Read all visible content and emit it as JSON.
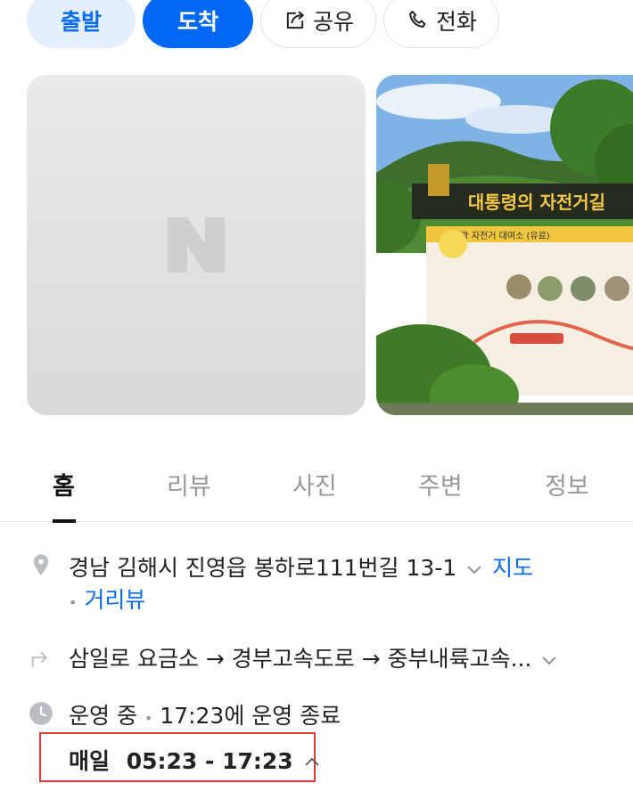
{
  "actions": {
    "depart": "출발",
    "arrive": "도착",
    "share": "공유",
    "call": "전화"
  },
  "photos": {
    "placeholder_logo": "N",
    "sign_title": "대통령의 자전거길",
    "sign_sub": "관광 자전거 대여소 (유료)"
  },
  "tabs": [
    {
      "label": "홈",
      "active": true
    },
    {
      "label": "리뷰",
      "active": false
    },
    {
      "label": "사진",
      "active": false
    },
    {
      "label": "주변",
      "active": false
    },
    {
      "label": "정보",
      "active": false
    }
  ],
  "address": {
    "text": "경남 김해시 진영읍 봉하로111번길 13-1",
    "map_link": "지도",
    "street_view_link": "거리뷰"
  },
  "route": {
    "text": "삼일로 요금소 → 경부고속도로 → 중부내륙고속..."
  },
  "hours": {
    "status": "운영 중",
    "close_info": "17:23에 운영 종료",
    "days": "매일",
    "time_range": "05:23 - 17:23"
  },
  "colors": {
    "accent": "#0068f5",
    "accent_light": "#e4effd",
    "highlight_box": "#e53935"
  }
}
